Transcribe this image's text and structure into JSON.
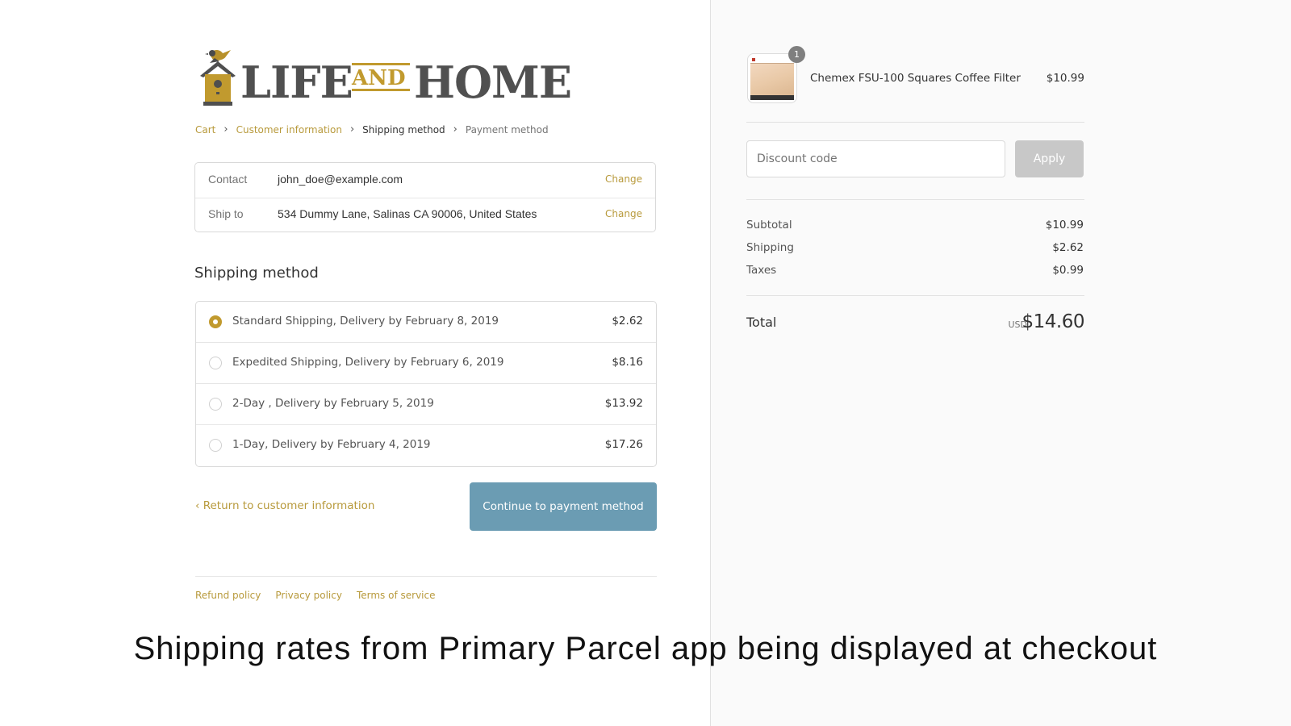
{
  "logo": {
    "word1": "LIFE",
    "word_and": "AND",
    "word2": "HOME",
    "icon": "birdhouse-icon"
  },
  "breadcrumb": {
    "cart": "Cart",
    "customer_information": "Customer information",
    "shipping_method": "Shipping method",
    "payment_method": "Payment method"
  },
  "review": {
    "contact_label": "Contact",
    "contact_value": "john_doe@example.com",
    "ship_to_label": "Ship to",
    "ship_to_value": "534 Dummy Lane, Salinas CA 90006, United States",
    "change_label": "Change"
  },
  "shipping": {
    "title": "Shipping method",
    "methods": [
      {
        "label": "Standard Shipping, Delivery by February 8, 2019",
        "price": "$2.62",
        "selected": true
      },
      {
        "label": "Expedited Shipping, Delivery by February 6, 2019",
        "price": "$8.16",
        "selected": false
      },
      {
        "label": "2-Day , Delivery by February 5, 2019",
        "price": "$13.92",
        "selected": false
      },
      {
        "label": "1-Day, Delivery by February 4, 2019",
        "price": "$17.26",
        "selected": false
      }
    ]
  },
  "actions": {
    "return_link": "Return to customer information",
    "continue_button": "Continue to payment method"
  },
  "footer": {
    "links": [
      "Refund policy",
      "Privacy policy",
      "Terms of service"
    ]
  },
  "order": {
    "product_name": "Chemex FSU-100 Squares Coffee Filter",
    "product_price": "$10.99",
    "quantity": "1",
    "discount_placeholder": "Discount code",
    "apply_label": "Apply",
    "subtotal_label": "Subtotal",
    "subtotal_value": "$10.99",
    "shipping_label": "Shipping",
    "shipping_value": "$2.62",
    "taxes_label": "Taxes",
    "taxes_value": "$0.99",
    "total_label": "Total",
    "currency": "USD",
    "total_value": "$14.60"
  },
  "caption": "Shipping rates from Primary Parcel app being displayed at checkout",
  "colors": {
    "accent": "#c19a2e",
    "link": "#b89a3c",
    "button": "#6b9cb3",
    "apply_disabled": "#c8c8c8",
    "sidebar_bg": "#fafafa"
  }
}
